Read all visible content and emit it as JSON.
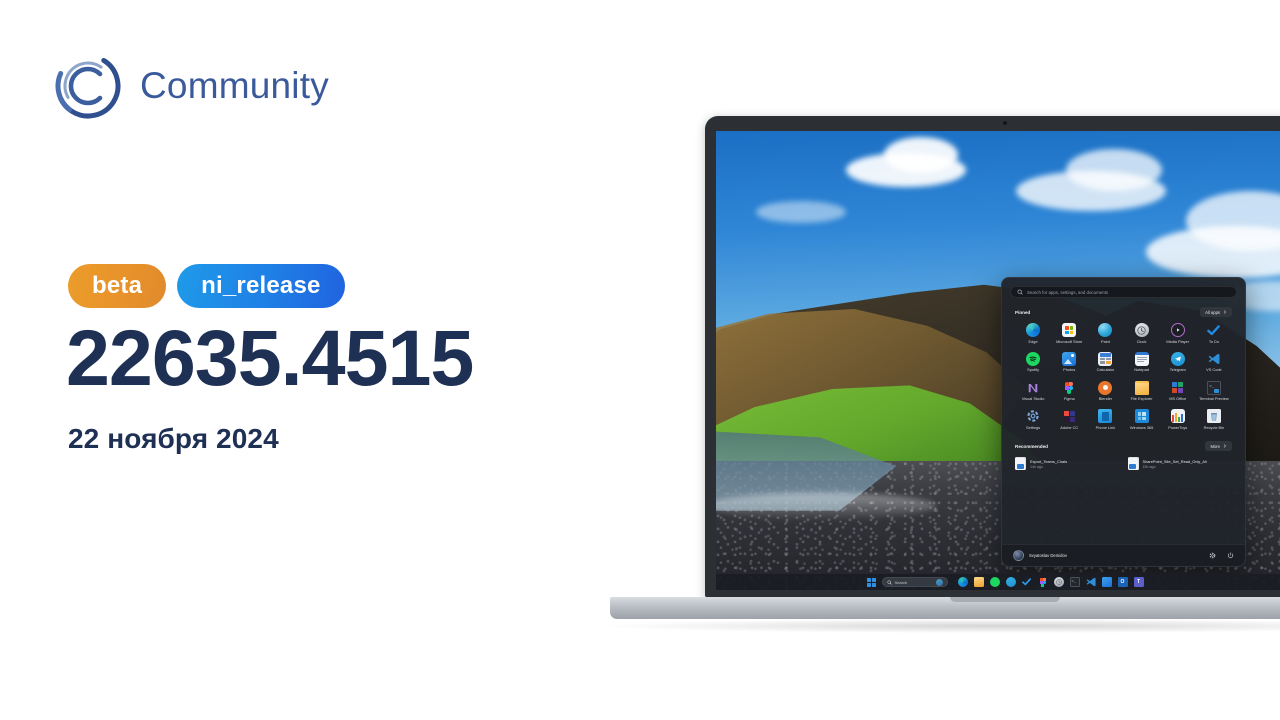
{
  "brand": {
    "logo_icon": "community-circle-c-logo",
    "name": "Community",
    "name_color": "#3a5a9b"
  },
  "release": {
    "badges": [
      {
        "label": "beta",
        "icon": "badge-beta",
        "color": "#e8922b"
      },
      {
        "label": "ni_release",
        "icon": "badge-branch",
        "color": "#1f7fe6"
      }
    ],
    "build_number": "22635.4515",
    "date": "22 ноября 2024",
    "text_color": "#1e3054"
  },
  "device": {
    "name": "laptop-mockup",
    "wallpaper": "iceland-black-beach-cliff"
  },
  "start_menu": {
    "search": {
      "placeholder": "Search for apps, settings, and documents",
      "icon": "search-icon"
    },
    "pinned": {
      "title": "Pinned",
      "all_apps_label": "All apps",
      "chevron": "chevron-right-icon",
      "apps": [
        {
          "label": "Edge",
          "icon": "edge-icon"
        },
        {
          "label": "Microsoft Store",
          "icon": "microsoft-store-icon"
        },
        {
          "label": "Paint",
          "icon": "paint-icon"
        },
        {
          "label": "Clock",
          "icon": "clock-icon"
        },
        {
          "label": "Media Player",
          "icon": "media-player-icon"
        },
        {
          "label": "To Do",
          "icon": "to-do-icon"
        },
        {
          "label": "Spotify",
          "icon": "spotify-icon"
        },
        {
          "label": "Photos",
          "icon": "photos-icon"
        },
        {
          "label": "Calculator",
          "icon": "calculator-icon"
        },
        {
          "label": "Notepad",
          "icon": "notepad-icon"
        },
        {
          "label": "Telegram",
          "icon": "telegram-icon"
        },
        {
          "label": "VS Code",
          "icon": "vs-code-icon"
        },
        {
          "label": "Visual Studio",
          "icon": "visual-studio-icon"
        },
        {
          "label": "Figma",
          "icon": "figma-icon"
        },
        {
          "label": "Blender",
          "icon": "blender-icon"
        },
        {
          "label": "File Explorer",
          "icon": "file-explorer-icon"
        },
        {
          "label": "MS Office",
          "icon": "ms-office-icon"
        },
        {
          "label": "Terminal Preview",
          "icon": "terminal-preview-icon"
        },
        {
          "label": "Settings",
          "icon": "settings-gear-icon"
        },
        {
          "label": "Adobe CC",
          "icon": "adobe-cc-icon"
        },
        {
          "label": "Phone Link",
          "icon": "phone-link-icon"
        },
        {
          "label": "Windows 365",
          "icon": "windows-365-icon"
        },
        {
          "label": "PowerToys",
          "icon": "powertoys-icon"
        },
        {
          "label": "Recycle Bin",
          "icon": "recycle-bin-icon"
        }
      ]
    },
    "recommended": {
      "title": "Recommended",
      "more_label": "More",
      "chevron": "chevron-right-icon",
      "items": [
        {
          "name": "Export_Teams_Chats",
          "time": "14h ago",
          "icon": "document-icon"
        },
        {
          "name": "SharePoint_Site_Set_Read_Only_All",
          "time": "15h ago",
          "icon": "document-icon"
        }
      ]
    },
    "footer": {
      "user_name": "Svyatoslav Demidov",
      "avatar": "user-avatar",
      "actions": [
        {
          "icon": "settings-gear-icon"
        },
        {
          "icon": "power-icon"
        }
      ]
    }
  },
  "taskbar": {
    "start_icon": "windows-start-icon",
    "search_label": "Search",
    "search_icon": "search-icon",
    "copilot_icon": "copilot-icon",
    "items": [
      {
        "icon": "edge-icon"
      },
      {
        "icon": "file-explorer-icon"
      },
      {
        "icon": "spotify-icon"
      },
      {
        "icon": "telegram-icon"
      },
      {
        "icon": "to-do-icon"
      },
      {
        "icon": "figma-icon"
      },
      {
        "icon": "clock-icon"
      },
      {
        "icon": "terminal-preview-icon"
      },
      {
        "icon": "vs-code-icon"
      },
      {
        "icon": "photos-icon"
      },
      {
        "icon": "outlook-icon"
      },
      {
        "icon": "teams-icon"
      }
    ]
  }
}
